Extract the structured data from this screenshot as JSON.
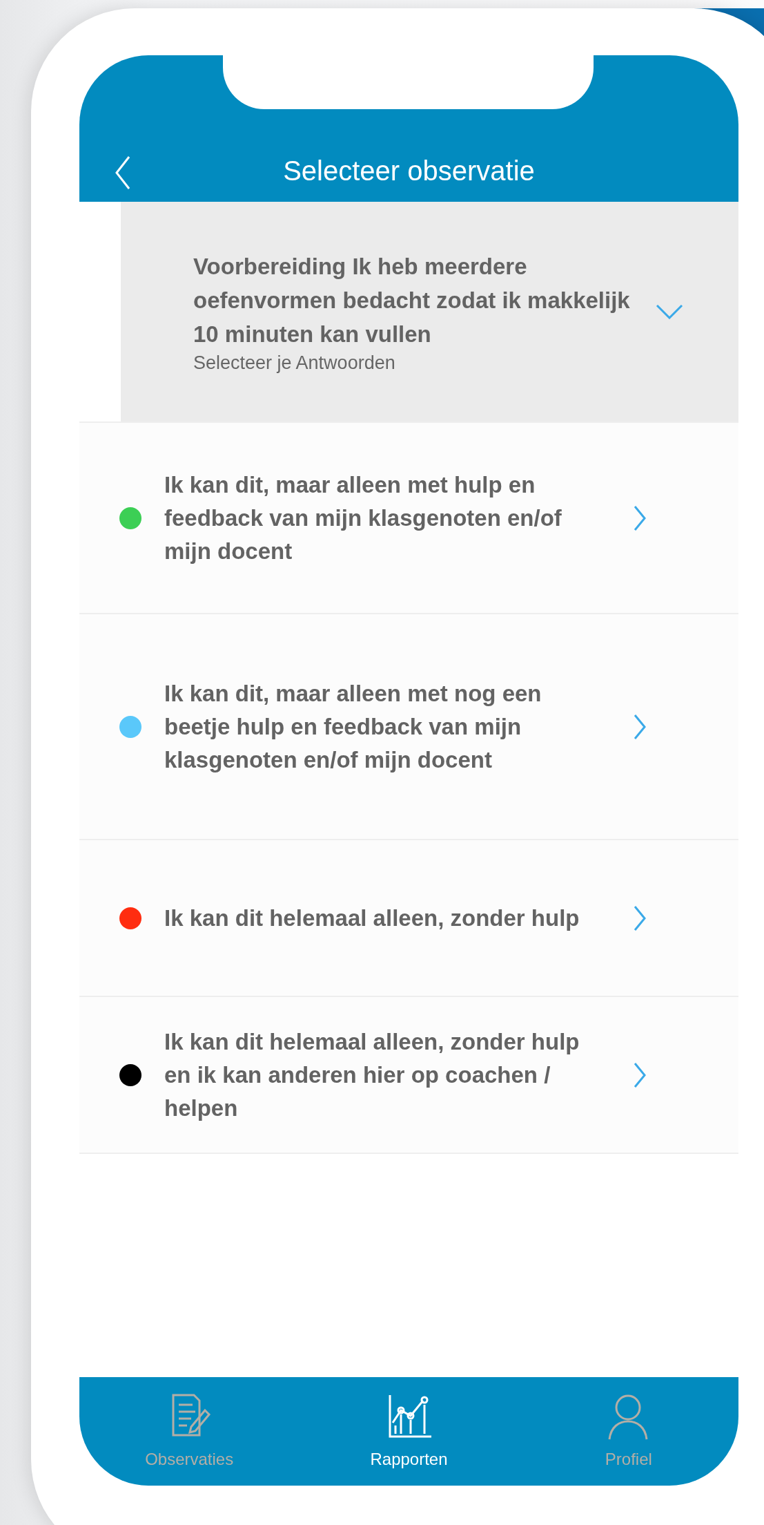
{
  "header": {
    "title": "Selecteer observatie"
  },
  "observation": {
    "title": "Voorbereiding Ik heb meerdere oefenvormen bedacht zodat ik makkelijk 10 minuten kan vullen",
    "subtitle": "Selecteer je Antwoorden",
    "expanded": true
  },
  "answers": [
    {
      "text": "Ik kan dit, maar alleen met hulp en feedback van mijn klasgenoten en/of mijn docent",
      "color": "#3ccf55"
    },
    {
      "text": "Ik kan dit, maar alleen met nog een beetje hulp en feedback van mijn klasgenoten en/of mijn docent",
      "color": "#5ac8fa"
    },
    {
      "text": "Ik kan dit helemaal alleen, zonder hulp",
      "color": "#ff2d10"
    },
    {
      "text": "Ik kan dit helemaal alleen, zonder hulp en ik kan anderen hier op coachen / helpen",
      "color": "#000000"
    }
  ],
  "tab_bar": [
    {
      "label": "Observaties",
      "selected": false
    },
    {
      "label": "Rapporten",
      "selected": true
    },
    {
      "label": "Profiel",
      "selected": false
    }
  ]
}
